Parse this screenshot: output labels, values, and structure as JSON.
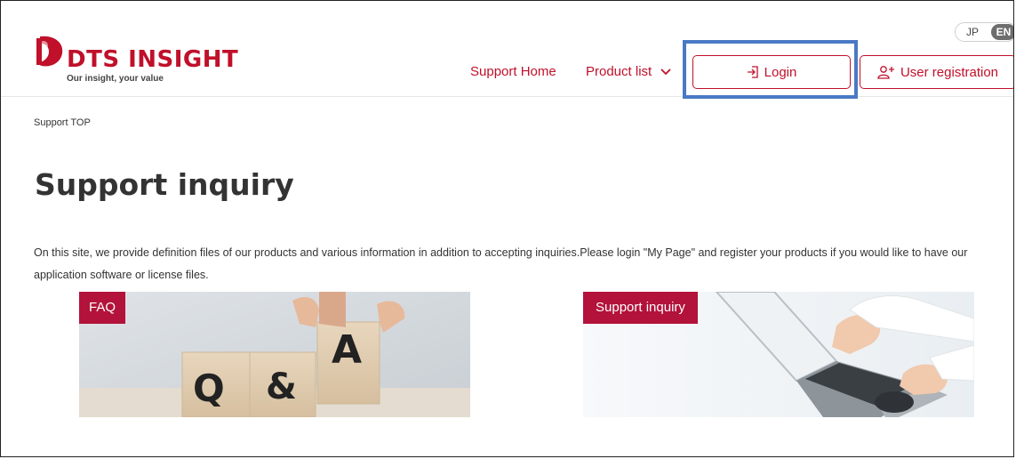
{
  "header": {
    "logo": {
      "name": "DTS INSIGHT",
      "tagline": "Our insight, your value"
    },
    "language": {
      "jp": "JP",
      "en": "EN",
      "selected": "EN"
    },
    "nav": {
      "support_home": "Support Home",
      "product_list": "Product list"
    },
    "buttons": {
      "login": "Login",
      "register": "User registration"
    }
  },
  "breadcrumb": "Support TOP",
  "page": {
    "title": "Support inquiry",
    "intro": "On this site, we provide definition files of our products and various information in addition to accepting inquiries.Please login \"My Page\" and register your products if you would like to have our application software or license files."
  },
  "cards": {
    "faq": {
      "label": "FAQ",
      "blocks": [
        "Q",
        "&",
        "A"
      ]
    },
    "inquiry": {
      "label": "Support inquiry"
    }
  },
  "colors": {
    "brand": "#c0102a",
    "card_label": "#b3123a",
    "focus": "#4a79c5"
  }
}
